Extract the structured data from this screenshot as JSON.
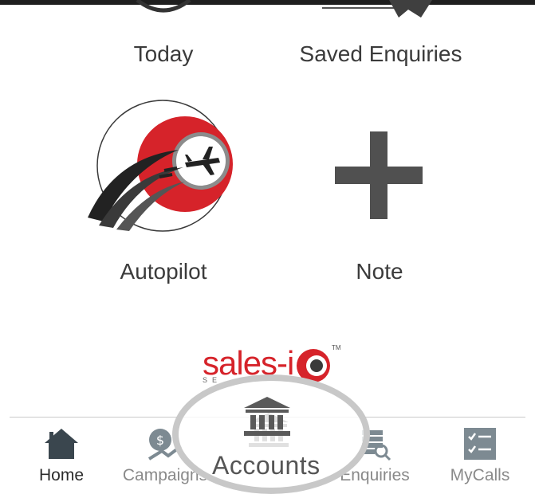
{
  "grid": {
    "today_label": "Today",
    "saved_enquiries_label": "Saved Enquiries",
    "autopilot_label": "Autopilot",
    "note_label": "Note"
  },
  "logo": {
    "text": "sales-i",
    "sub": "SE",
    "trademark": "TM"
  },
  "tabbar": {
    "tabs": [
      {
        "label": "Home",
        "icon": "home-icon",
        "active": true
      },
      {
        "label": "Campaigns",
        "icon": "campaigns-icon",
        "active": false
      },
      {
        "label": "Accounts",
        "icon": "bank-icon",
        "active": false
      },
      {
        "label": "Enquiries",
        "icon": "enquiries-icon",
        "active": false
      },
      {
        "label": "MyCalls",
        "icon": "mycalls-icon",
        "active": false
      }
    ]
  },
  "highlight": {
    "label": "Accounts"
  },
  "colors": {
    "brand_red": "#d6232a",
    "icon_gray": "#555555",
    "tab_inactive": "#8a8a8a",
    "tab_icon_dark": "#3a464e"
  }
}
